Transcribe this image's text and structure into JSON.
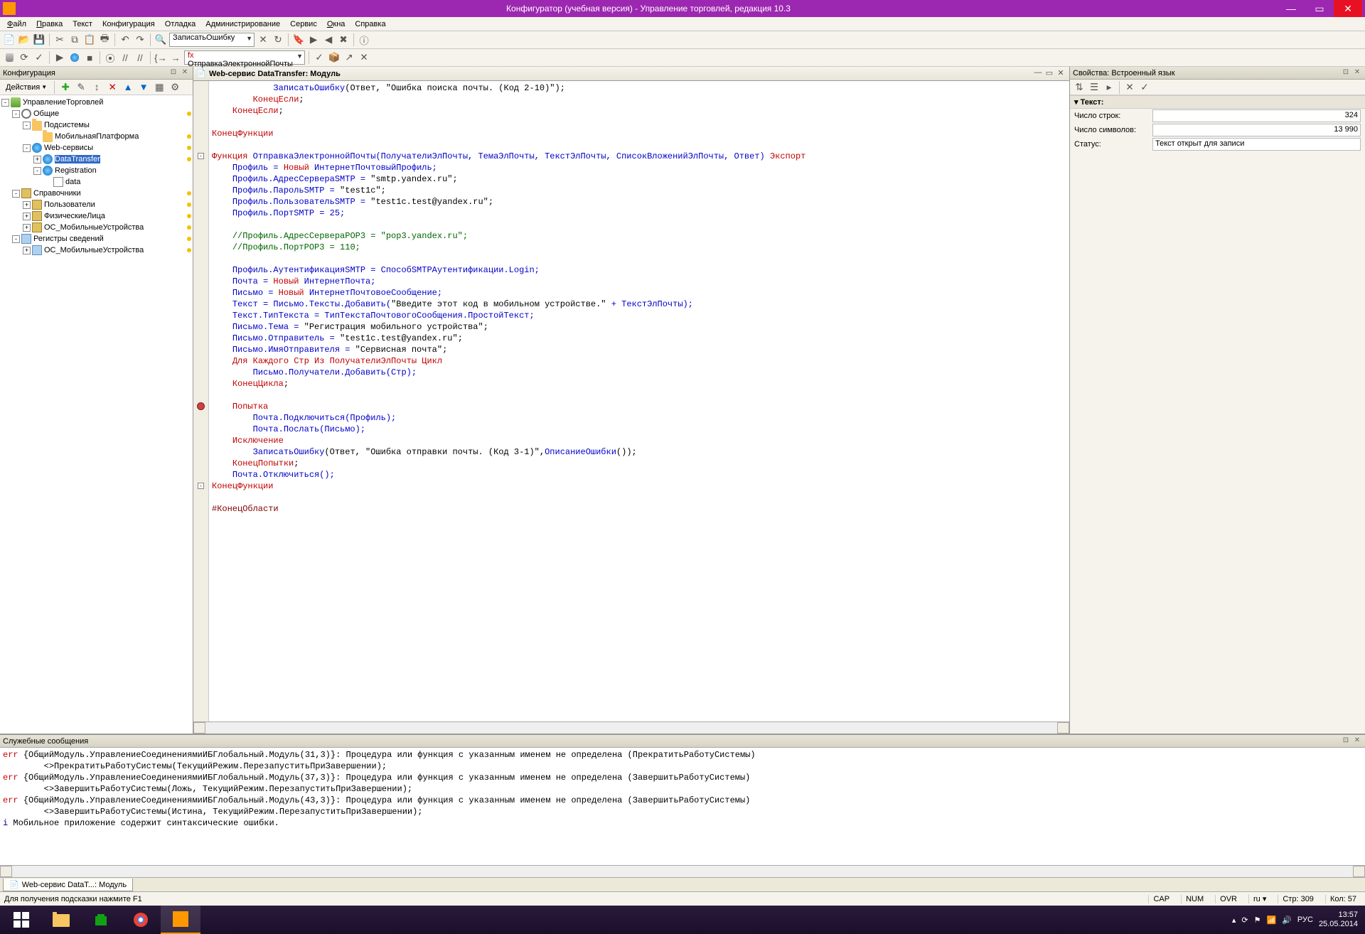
{
  "title": "Конфигуратор (учебная версия) - Управление торговлей, редакция 10.3",
  "menu": [
    "Файл",
    "Правка",
    "Текст",
    "Конфигурация",
    "Отладка",
    "Администрирование",
    "Сервис",
    "Окна",
    "Справка"
  ],
  "menu_ul": [
    "Ф",
    "П",
    "",
    "",
    "",
    "",
    "",
    "О",
    ""
  ],
  "combo1": "ЗаписатьОшибку",
  "combo2": "ОтправкаЭлектроннойПочты",
  "left_panel": {
    "title": "Конфигурация",
    "actions": "Действия"
  },
  "tree": {
    "root": "УправлениеТорговлей",
    "n1": "Общие",
    "n1a": "Подсистемы",
    "n1a1": "МобильнаяПлатформа",
    "n1b": "Web-сервисы",
    "n1b1": "DataTransfer",
    "n1b2": "Registration",
    "n1b2a": "data",
    "n2": "Справочники",
    "n2a": "Пользователи",
    "n2b": "ФизическиеЛица",
    "n2c": "ОС_МобильныеУстройства",
    "n3": "Регистры сведений",
    "n3a": "ОС_МобильныеУстройства"
  },
  "editor": {
    "tab_title": "Web-сервис DataTransfer: Модуль"
  },
  "code_lines": [
    {
      "indent": 3,
      "tokens": [
        {
          "t": "ЗаписатьОшибку",
          "c": "kw-blue"
        },
        {
          "t": "(Ответ, ",
          "c": ""
        },
        {
          "t": "\"Ошибка поиска почты. (Код 2-10)\"",
          "c": "kw-str"
        },
        {
          "t": ");",
          "c": ""
        }
      ]
    },
    {
      "indent": 2,
      "tokens": [
        {
          "t": "КонецЕсли",
          "c": "kw-red"
        },
        {
          "t": ";",
          "c": ""
        }
      ]
    },
    {
      "indent": 1,
      "tokens": [
        {
          "t": "КонецЕсли",
          "c": "kw-red"
        },
        {
          "t": ";",
          "c": ""
        }
      ]
    },
    {
      "indent": 0,
      "tokens": []
    },
    {
      "indent": 0,
      "tokens": [
        {
          "t": "КонецФункции",
          "c": "kw-red"
        }
      ]
    },
    {
      "indent": 0,
      "tokens": []
    },
    {
      "indent": 0,
      "fold": "-",
      "tokens": [
        {
          "t": "Функция ",
          "c": "kw-red"
        },
        {
          "t": "ОтправкаЭлектроннойПочты",
          "c": "kw-blue"
        },
        {
          "t": "(ПолучателиЭлПочты, ТемаЭлПочты, ТекстЭлПочты, СписокВложенийЭлПочты, Ответ) ",
          "c": "kw-blue"
        },
        {
          "t": "Экспорт",
          "c": "kw-red"
        }
      ]
    },
    {
      "indent": 1,
      "tokens": [
        {
          "t": "Профиль = ",
          "c": "kw-blue"
        },
        {
          "t": "Новый ",
          "c": "kw-red"
        },
        {
          "t": "ИнтернетПочтовыйПрофиль;",
          "c": "kw-blue"
        }
      ]
    },
    {
      "indent": 1,
      "tokens": [
        {
          "t": "Профиль.АдресСервераSMTP = ",
          "c": "kw-blue"
        },
        {
          "t": "\"smtp.yandex.ru\"",
          "c": "kw-str"
        },
        {
          "t": ";",
          "c": ""
        }
      ]
    },
    {
      "indent": 1,
      "tokens": [
        {
          "t": "Профиль.ПарольSMTP = ",
          "c": "kw-blue"
        },
        {
          "t": "\"test1c\"",
          "c": "kw-str"
        },
        {
          "t": ";",
          "c": ""
        }
      ]
    },
    {
      "indent": 1,
      "tokens": [
        {
          "t": "Профиль.ПользовательSMTP = ",
          "c": "kw-blue"
        },
        {
          "t": "\"test1c.test@yandex.ru\"",
          "c": "kw-str"
        },
        {
          "t": ";",
          "c": ""
        }
      ]
    },
    {
      "indent": 1,
      "tokens": [
        {
          "t": "Профиль.ПортSMTP = ",
          "c": "kw-blue"
        },
        {
          "t": "25;",
          "c": "kw-blue"
        }
      ]
    },
    {
      "indent": 0,
      "tokens": []
    },
    {
      "indent": 1,
      "tokens": [
        {
          "t": "//Профиль.АдресСервераPOP3 = \"pop3.yandex.ru\";",
          "c": "kw-comment"
        }
      ]
    },
    {
      "indent": 1,
      "tokens": [
        {
          "t": "//Профиль.ПортPOP3 = 110;",
          "c": "kw-comment"
        }
      ]
    },
    {
      "indent": 0,
      "tokens": []
    },
    {
      "indent": 1,
      "tokens": [
        {
          "t": "Профиль.АутентификацияSMTP = СпособSMTPАутентификации.Login;",
          "c": "kw-blue"
        }
      ]
    },
    {
      "indent": 1,
      "tokens": [
        {
          "t": "Почта = ",
          "c": "kw-blue"
        },
        {
          "t": "Новый ",
          "c": "kw-red"
        },
        {
          "t": "ИнтернетПочта;",
          "c": "kw-blue"
        }
      ]
    },
    {
      "indent": 1,
      "tokens": [
        {
          "t": "Письмо = ",
          "c": "kw-blue"
        },
        {
          "t": "Новый ",
          "c": "kw-red"
        },
        {
          "t": "ИнтернетПочтовоеСообщение;",
          "c": "kw-blue"
        }
      ]
    },
    {
      "indent": 1,
      "tokens": [
        {
          "t": "Текст = Письмо.Тексты.Добавить(",
          "c": "kw-blue"
        },
        {
          "t": "\"Введите этот код в мобильном устройстве.\"",
          "c": "kw-str"
        },
        {
          "t": " + ТекстЭлПочты);",
          "c": "kw-blue"
        }
      ]
    },
    {
      "indent": 1,
      "tokens": [
        {
          "t": "Текст.ТипТекста = ТипТекстаПочтовогоСообщения.ПростойТекст;",
          "c": "kw-blue"
        }
      ]
    },
    {
      "indent": 1,
      "tokens": [
        {
          "t": "Письмо.Тема = ",
          "c": "kw-blue"
        },
        {
          "t": "\"Регистрация мобильного устройства\"",
          "c": "kw-str"
        },
        {
          "t": ";",
          "c": ""
        }
      ]
    },
    {
      "indent": 1,
      "tokens": [
        {
          "t": "Письмо.Отправитель = ",
          "c": "kw-blue"
        },
        {
          "t": "\"test1c.test@yandex.ru\"",
          "c": "kw-str"
        },
        {
          "t": ";",
          "c": ""
        }
      ]
    },
    {
      "indent": 1,
      "tokens": [
        {
          "t": "Письмо.ИмяОтправителя = ",
          "c": "kw-blue"
        },
        {
          "t": "\"Сервисная почта\"",
          "c": "kw-str"
        },
        {
          "t": ";",
          "c": ""
        }
      ]
    },
    {
      "indent": 1,
      "tokens": [
        {
          "t": "Для Каждого Стр Из ПолучателиЭлПочты Цикл",
          "c": "kw-red"
        }
      ]
    },
    {
      "indent": 2,
      "tokens": [
        {
          "t": "Письмо.Получатели.Добавить(Стр);",
          "c": "kw-blue"
        }
      ]
    },
    {
      "indent": 1,
      "tokens": [
        {
          "t": "КонецЦикла",
          "c": "kw-red"
        },
        {
          "t": ";",
          "c": ""
        }
      ]
    },
    {
      "indent": 0,
      "tokens": []
    },
    {
      "indent": 1,
      "brk": true,
      "tokens": [
        {
          "t": "Попытка",
          "c": "kw-red"
        }
      ]
    },
    {
      "indent": 2,
      "tokens": [
        {
          "t": "Почта.Подключиться(Профиль);",
          "c": "kw-blue"
        }
      ]
    },
    {
      "indent": 2,
      "tokens": [
        {
          "t": "Почта.Послать(Письмо);",
          "c": "kw-blue"
        }
      ]
    },
    {
      "indent": 1,
      "tokens": [
        {
          "t": "Исключение",
          "c": "kw-red"
        }
      ]
    },
    {
      "indent": 2,
      "tokens": [
        {
          "t": "ЗаписатьОшибку",
          "c": "kw-blue"
        },
        {
          "t": "(Ответ, ",
          "c": ""
        },
        {
          "t": "\"Ошибка отправки почты. (Код 3-1)\"",
          "c": "kw-str"
        },
        {
          "t": ",",
          "c": ""
        },
        {
          "t": "ОписаниеОшибки",
          "c": "kw-blue"
        },
        {
          "t": "());",
          "c": ""
        }
      ]
    },
    {
      "indent": 1,
      "tokens": [
        {
          "t": "КонецПопытки",
          "c": "kw-red"
        },
        {
          "t": ";",
          "c": ""
        }
      ]
    },
    {
      "indent": 1,
      "tokens": [
        {
          "t": "Почта.Отключиться();",
          "c": "kw-blue"
        }
      ]
    },
    {
      "indent": 0,
      "fold": "-",
      "tokens": [
        {
          "t": "КонецФункции",
          "c": "kw-red"
        }
      ]
    },
    {
      "indent": 0,
      "tokens": []
    },
    {
      "indent": 0,
      "tokens": [
        {
          "t": "#КонецОбласти",
          "c": "kw-brown"
        }
      ]
    }
  ],
  "right_panel": {
    "title": "Свойства: Встроенный язык",
    "section": "Текст:",
    "rows": [
      {
        "label": "Число строк:",
        "value": "324"
      },
      {
        "label": "Число символов:",
        "value": "13 990"
      },
      {
        "label": "Статус:",
        "value": "Текст открыт для записи",
        "left": true
      }
    ]
  },
  "messages": {
    "title": "Служебные сообщения",
    "lines": [
      {
        "tag": "err",
        "text": "{ОбщийМодуль.УправлениеСоединениямиИБГлобальный.Модуль(31,3)}: Процедура или функция с указанным именем не определена (ПрекратитьРаботуСистемы)"
      },
      {
        "tag": "",
        "text": "        <<?>>ПрекратитьРаботуСистемы(ТекущийРежим.ПерезапуститьПриЗавершении);"
      },
      {
        "tag": "err",
        "text": "{ОбщийМодуль.УправлениеСоединениямиИБГлобальный.Модуль(37,3)}: Процедура или функция с указанным именем не определена (ЗавершитьРаботуСистемы)"
      },
      {
        "tag": "",
        "text": "        <<?>>ЗавершитьРаботуСистемы(Ложь, ТекущийРежим.ПерезапуститьПриЗавершении);"
      },
      {
        "tag": "err",
        "text": "{ОбщийМодуль.УправлениеСоединениямиИБГлобальный.Модуль(43,3)}: Процедура или функция с указанным именем не определена (ЗавершитьРаботуСистемы)"
      },
      {
        "tag": "",
        "text": "        <<?>>ЗавершитьРаботуСистемы(Истина, ТекущийРежим.ПерезапуститьПриЗавершении);"
      },
      {
        "tag": "i",
        "text": "Мобильное приложение содержит синтаксические ошибки."
      }
    ]
  },
  "doc_tab": "Web-сервис DataT...: Модуль",
  "status": {
    "hint": "Для получения подсказки нажмите F1",
    "cap": "CAP",
    "num": "NUM",
    "ovr": "OVR",
    "lang": "ru",
    "line": "Стр: 309",
    "col": "Кол: 57"
  },
  "tray": {
    "lang": "РУС",
    "time": "13:57",
    "date": "25.05.2014"
  }
}
